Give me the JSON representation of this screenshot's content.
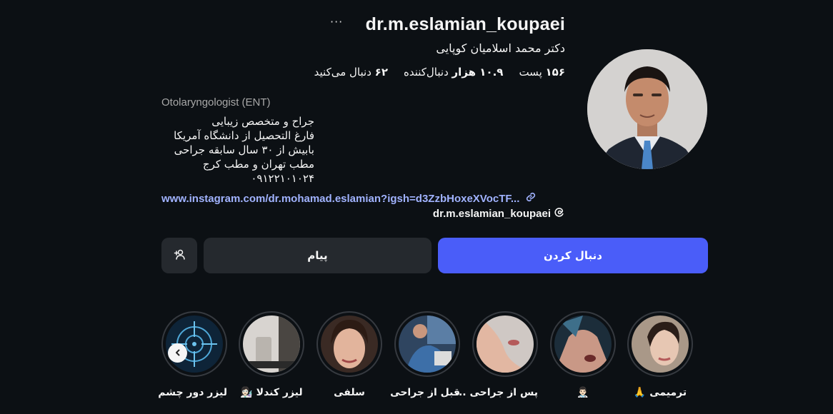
{
  "profile": {
    "username": "dr.m.eslamian_koupaei",
    "more_glyph": "···",
    "full_name": "دکتر محمد اسلامیان کوپایی",
    "stats": {
      "posts": {
        "count": "۱۵۶",
        "label": "پست"
      },
      "followers": {
        "count": "۱۰.۹ هزار",
        "label": "دنبال‌کننده"
      },
      "following": {
        "count": "۶۲",
        "label": "دنبال می‌کنید"
      }
    },
    "category": "Otolaryngologist (ENT)",
    "bio_lines": [
      "جراح و متخصص زیبایی",
      "فارغ التحصیل از دانشگاه آمریکا",
      "بابیش از ۳۰ سال سابقه جراحی",
      "مطب تهران و مطب کرج",
      "۰۹۱۲۲۱۰۱۰۲۴"
    ],
    "link_text": "www.instagram.com/dr.mohamad.eslamian?igsh=d3ZzbHoxeXVocTF...",
    "threads_handle": "dr.m.eslamian_koupaei"
  },
  "actions": {
    "follow_label": "دنبال کردن",
    "message_label": "پیام"
  },
  "colors": {
    "background": "#0c1014",
    "follow_button": "#4a5df9",
    "secondary_button": "#25292e",
    "link": "#a1b3ff"
  },
  "highlights": [
    {
      "label": "ترمیمی 🙏"
    },
    {
      "label": "👨🏻‍⚕️"
    },
    {
      "label": "پس از جراحی ..."
    },
    {
      "label": "قبل از جراحی"
    },
    {
      "label": "سلفی"
    },
    {
      "label": "لیزر کندلا 👩🏻‍🔬"
    },
    {
      "label": "لیزر دور چشم"
    }
  ],
  "icons": {
    "more": "more-horizontal-icon",
    "link": "link-icon",
    "threads": "threads-icon",
    "add_user": "add-user-icon",
    "prev": "chevron-left-icon"
  }
}
